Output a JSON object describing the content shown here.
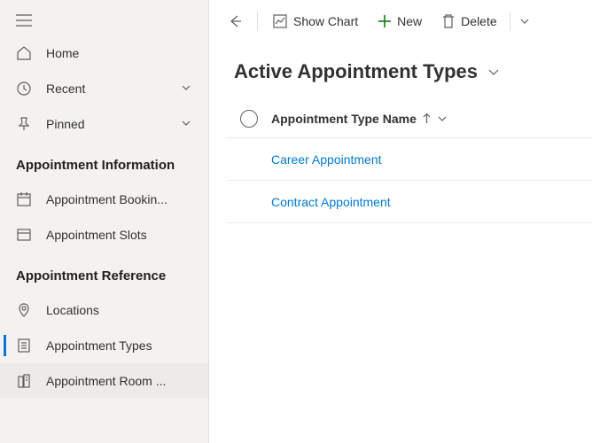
{
  "sidebar": {
    "groups": [
      {
        "items": [
          {
            "name": "home",
            "label": "Home",
            "chevron": false
          },
          {
            "name": "recent",
            "label": "Recent",
            "chevron": true
          },
          {
            "name": "pinned",
            "label": "Pinned",
            "chevron": true
          }
        ]
      }
    ],
    "section1": {
      "title": "Appointment Information",
      "items": [
        {
          "name": "appointment-booking",
          "label": "Appointment Bookin..."
        },
        {
          "name": "appointment-slots",
          "label": "Appointment Slots"
        }
      ]
    },
    "section2": {
      "title": "Appointment Reference",
      "items": [
        {
          "name": "locations",
          "label": "Locations"
        },
        {
          "name": "appointment-types",
          "label": "Appointment Types",
          "selected": true
        },
        {
          "name": "appointment-room",
          "label": "Appointment Room ...",
          "hovered": true
        }
      ]
    }
  },
  "commandbar": {
    "back": "Back",
    "showChart": "Show Chart",
    "new": "New",
    "delete": "Delete"
  },
  "view": {
    "title": "Active Appointment Types"
  },
  "grid": {
    "column": "Appointment Type Name",
    "sort": "asc",
    "rows": [
      {
        "name": "Career Appointment"
      },
      {
        "name": "Contract Appointment"
      }
    ]
  },
  "colors": {
    "accent": "#0078d4",
    "newGreen": "#107c10"
  }
}
